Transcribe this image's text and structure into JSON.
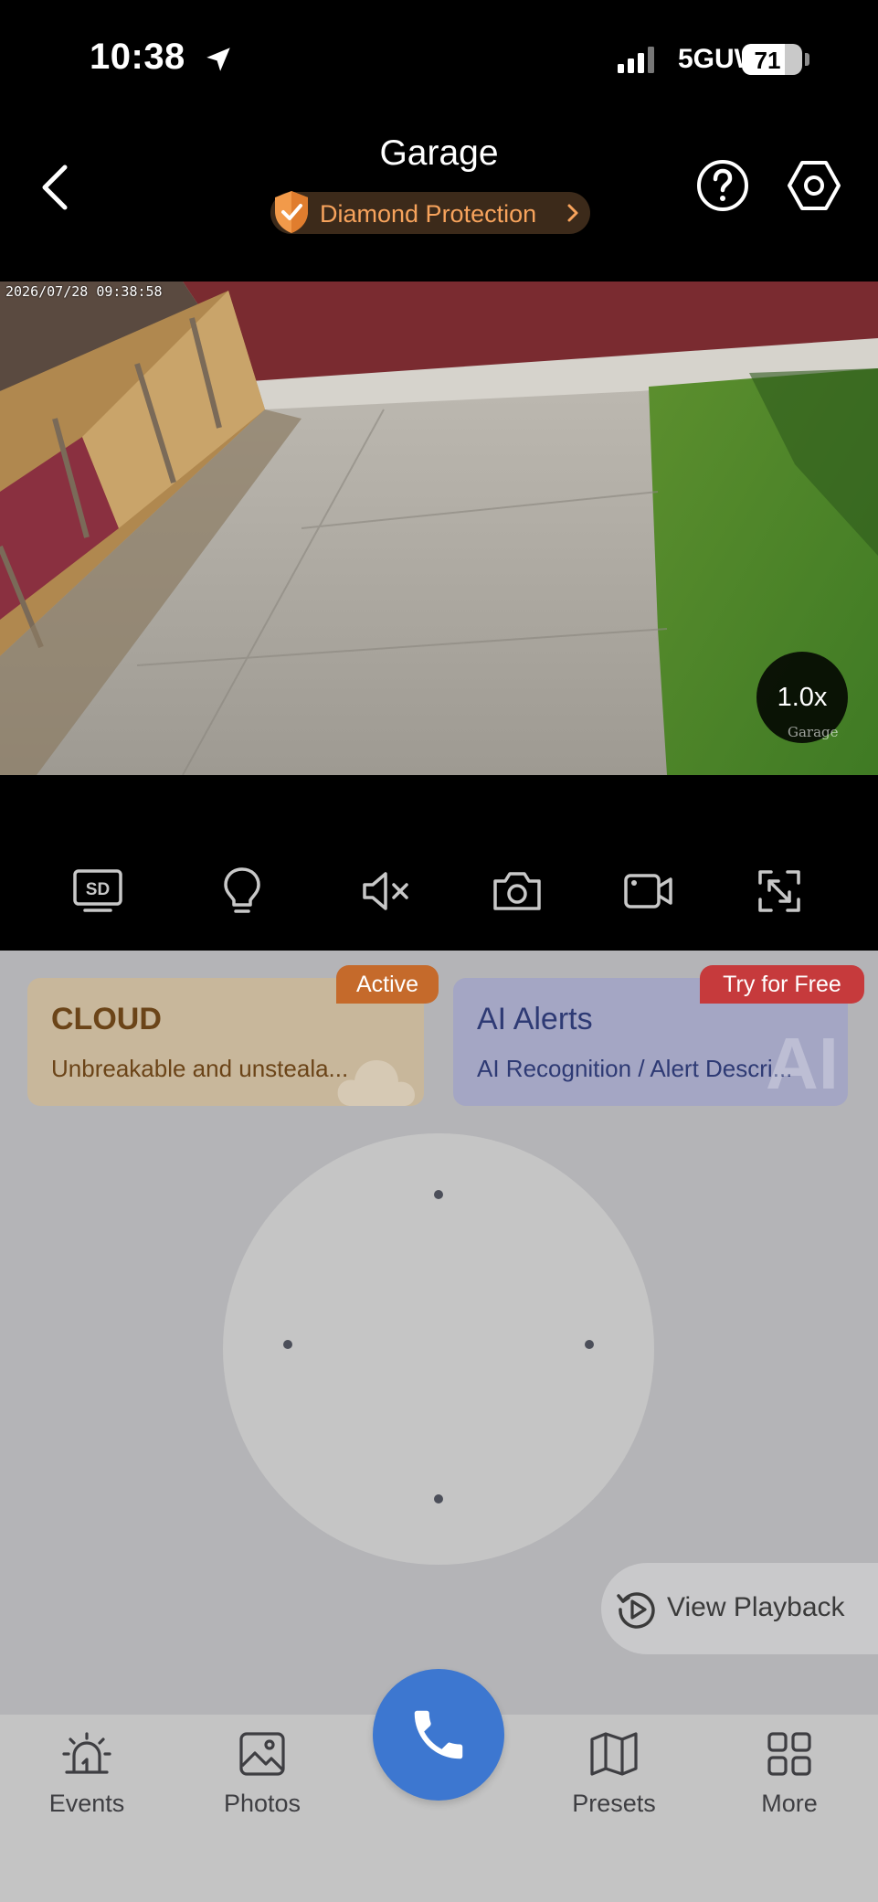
{
  "status_bar": {
    "time": "10:38",
    "network": "5GUW",
    "battery_level": "71",
    "battery_fraction": 0.71
  },
  "header": {
    "title": "Garage",
    "protection_label": "Diamond Protection",
    "accent_color": "#f7a35c"
  },
  "camera": {
    "timestamp": "2026/07/28 09:38:58",
    "zoom": "1.0x",
    "camera_label": "Garage"
  },
  "toolbar": {
    "icons": [
      "sd-quality-icon",
      "light-bulb-icon",
      "mute-icon",
      "snapshot-icon",
      "record-icon",
      "fullscreen-icon"
    ]
  },
  "cards": {
    "cloud": {
      "badge": "Active",
      "title": "CLOUD",
      "subtitle": "Unbreakable and unsteala..."
    },
    "ai": {
      "badge": "Try for Free",
      "title": "AI Alerts",
      "subtitle": "AI Recognition / Alert Descri...",
      "watermark": "AI"
    }
  },
  "playback": {
    "label": "View Playback"
  },
  "bottom_nav": {
    "events": "Events",
    "photos": "Photos",
    "presets": "Presets",
    "more": "More",
    "call_color": "#3d77d0"
  }
}
